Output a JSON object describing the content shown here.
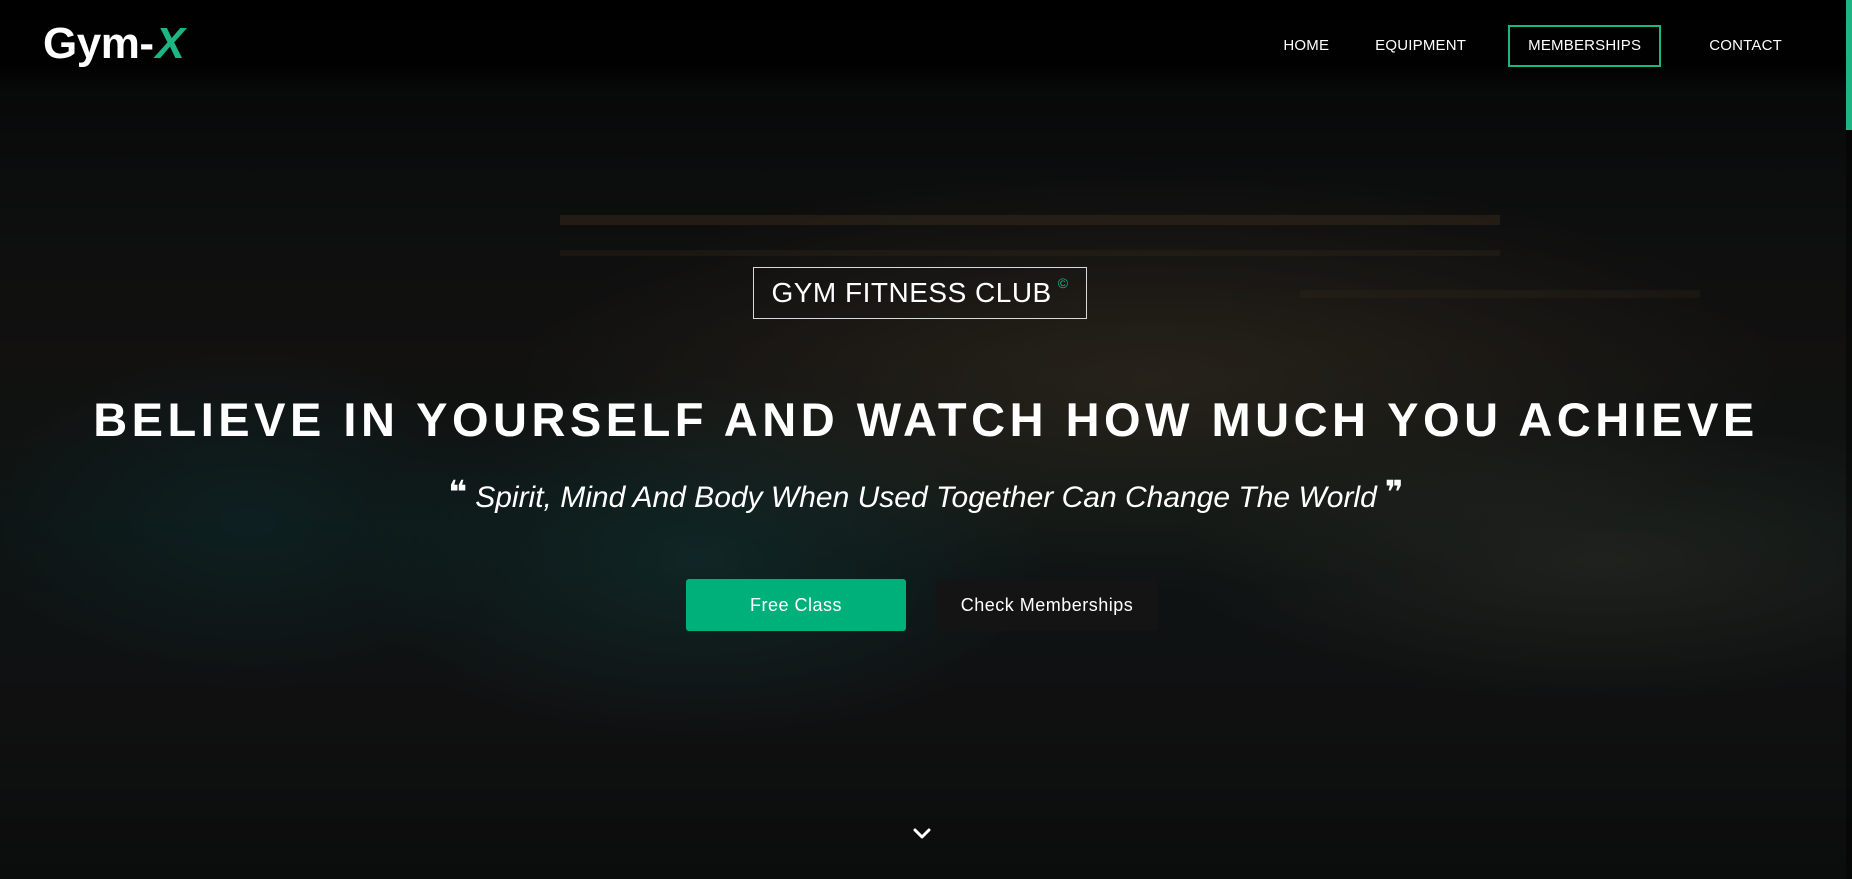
{
  "brand": {
    "logo_main": "Gym-",
    "logo_accent": "X",
    "accent_color": "#1db584"
  },
  "nav": {
    "items": [
      {
        "label": "HOME",
        "active": false
      },
      {
        "label": "EQUIPMENT",
        "active": false
      },
      {
        "label": "MEMBERSHIPS",
        "active": true
      },
      {
        "label": "CONTACT",
        "active": false
      }
    ]
  },
  "hero": {
    "badge_text": "GYM FITNESS CLUB",
    "badge_symbol": "©",
    "headline": "BELIEVE IN YOURSELF AND WATCH HOW MUCH YOU ACHIEVE",
    "quote_open": "❝",
    "quote_text": "Spirit, Mind And Body When Used Together Can Change The World",
    "quote_close": "❞",
    "primary_button": "Free Class",
    "secondary_button": "Check Memberships",
    "primary_color": "#00b07b",
    "scroll_icon": "chevron-down-icon"
  }
}
